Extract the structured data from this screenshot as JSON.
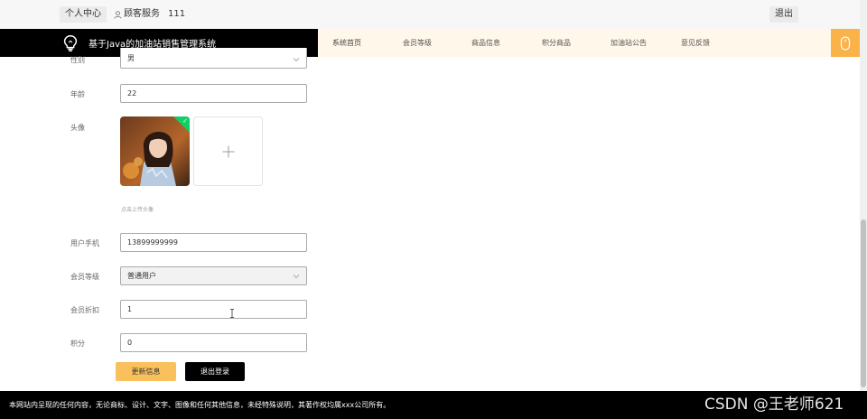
{
  "topbar": {
    "user_center": "个人中心",
    "customer_service": "顾客服务",
    "user_number": "111",
    "logout": "退出"
  },
  "brand": {
    "title": "基于Java的加油站销售管理系统",
    "icon": "lightbulb-icon"
  },
  "nav": {
    "items": [
      {
        "label": "系统首页"
      },
      {
        "label": "会员等级"
      },
      {
        "label": "商品信息"
      },
      {
        "label": "积分商品"
      },
      {
        "label": "加油站公告"
      },
      {
        "label": "意见反馈"
      }
    ],
    "corner_icon": "mouse-icon"
  },
  "form": {
    "gender": {
      "label": "性别",
      "value": "男"
    },
    "age": {
      "label": "年龄",
      "value": "22"
    },
    "avatar": {
      "label": "头像",
      "hint": "点击上传头像"
    },
    "phone": {
      "label": "用户手机",
      "value": "13899999999"
    },
    "member_level": {
      "label": "会员等级",
      "value": "普通用户"
    },
    "discount": {
      "label": "会员折扣",
      "value": "1"
    },
    "points": {
      "label": "积分",
      "value": "0"
    }
  },
  "buttons": {
    "update": "更新信息",
    "logout": "退出登录"
  },
  "footer": {
    "text": "本网站内呈现的任何内容，无论商标、设计、文字、图像和任何其他信息，未经特殊说明，其著作权均属xxx公司所有。",
    "watermark": "CSDN @王老师621"
  },
  "colors": {
    "accent": "#f9c05c",
    "nav_bg": "#fff7e9",
    "corner": "#f9b349",
    "success": "#13ce66"
  }
}
